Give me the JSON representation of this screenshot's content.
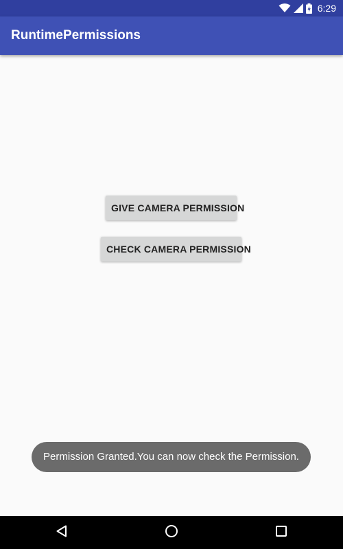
{
  "status_bar": {
    "time": "6:29",
    "icons": [
      "wifi-icon",
      "signal-icon",
      "battery-icon"
    ]
  },
  "app_bar": {
    "title": "RuntimePermissions"
  },
  "buttons": {
    "give_label": "GIVE CAMERA PERMISSION",
    "check_label": "CHECK CAMERA PERMISSION"
  },
  "toast": {
    "message": "Permission Granted.You can now check the Permission."
  },
  "nav_bar": {
    "icons": [
      "back-icon",
      "home-icon",
      "recents-icon"
    ]
  },
  "colors": {
    "status_bar": "#303f9f",
    "app_bar": "#3f51b5",
    "background": "#fafafa",
    "button": "#d6d7d7",
    "toast": "#6b6b6b",
    "nav_bar": "#000000"
  }
}
